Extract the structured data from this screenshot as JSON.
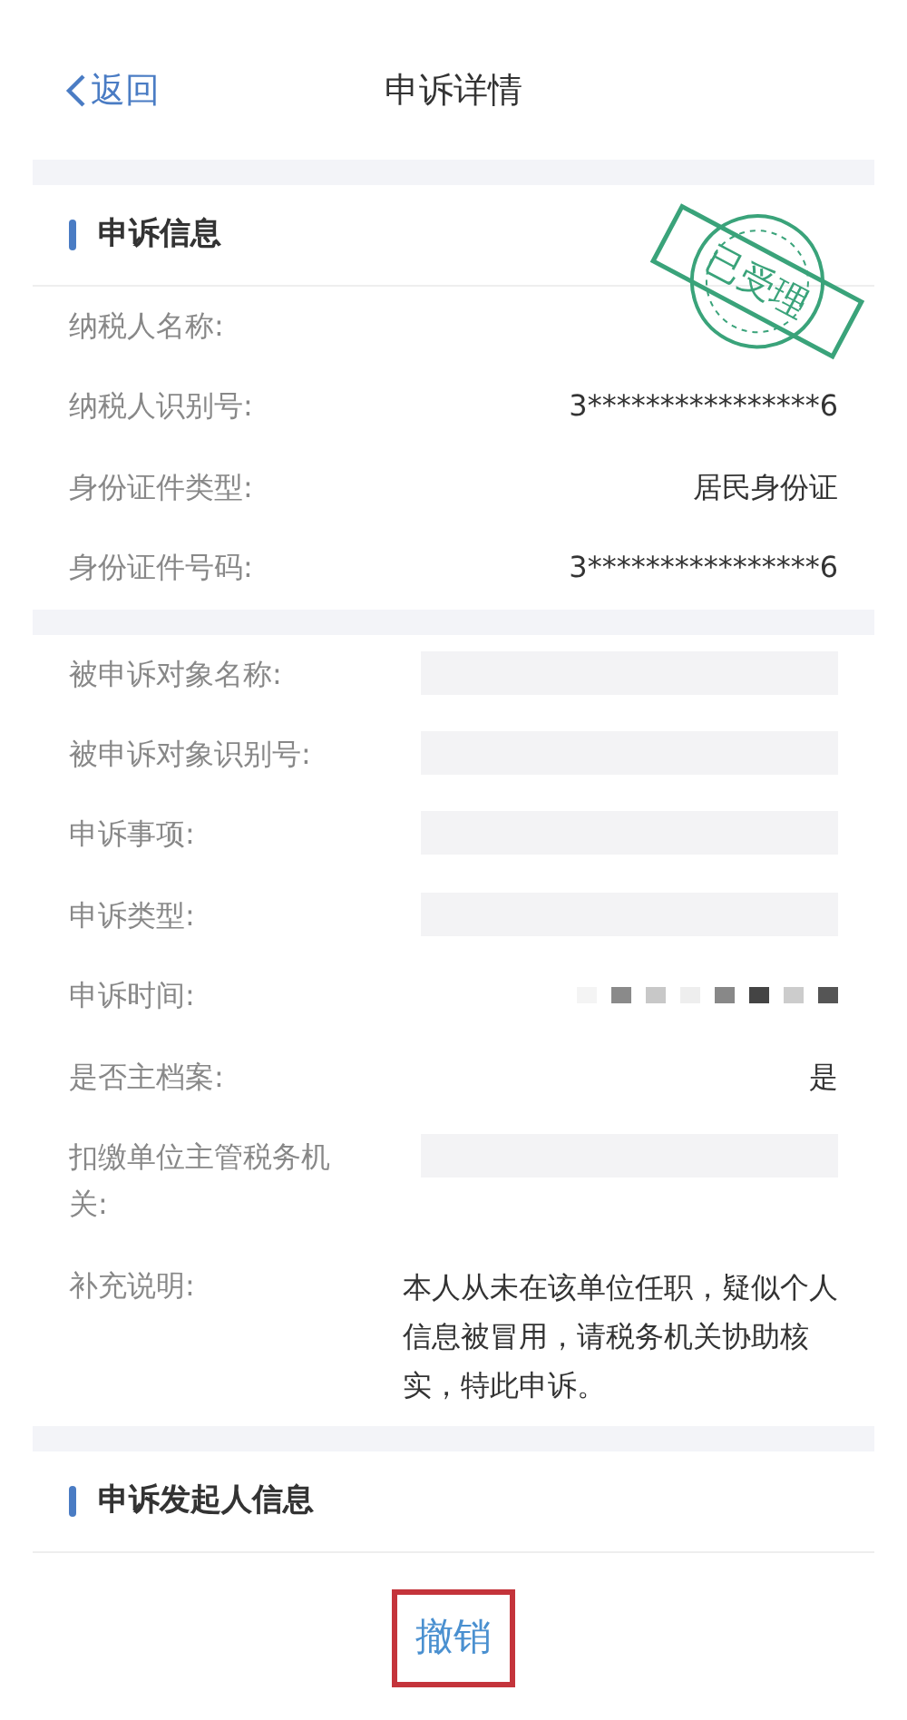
{
  "nav": {
    "back": "返回",
    "title": "申诉详情"
  },
  "stamp": {
    "text": "已受理"
  },
  "sections": [
    {
      "heading": "申诉信息",
      "rows": [
        {
          "label": "纳税人名称:",
          "kind": "empty"
        },
        {
          "label": "纳税人识别号:",
          "kind": "text",
          "value": "3****************6"
        },
        {
          "label": "身份证件类型:",
          "kind": "text",
          "value": "居民身份证"
        },
        {
          "label": "身份证件号码:",
          "kind": "text",
          "value": "3****************6"
        }
      ]
    },
    {
      "rows": [
        {
          "label": "被申诉对象名称:",
          "kind": "redacted"
        },
        {
          "label": "被申诉对象识别号:",
          "kind": "redacted"
        },
        {
          "label": "申诉事项:",
          "kind": "redacted"
        },
        {
          "label": "申诉类型:",
          "kind": "redacted"
        },
        {
          "label": "申诉时间:",
          "kind": "pixelated"
        },
        {
          "label": "是否主档案:",
          "kind": "text",
          "value": "是"
        },
        {
          "label": "扣缴单位主管税务机关:",
          "kind": "redacted"
        },
        {
          "label": "补充说明:",
          "kind": "note",
          "value": "本人从未在该单位任职，疑似个人信息被冒用，请税务机关协助核实，特此申诉。"
        }
      ]
    },
    {
      "heading": "申诉发起人信息"
    }
  ],
  "action": {
    "label": "撤销",
    "highlighted": true
  }
}
